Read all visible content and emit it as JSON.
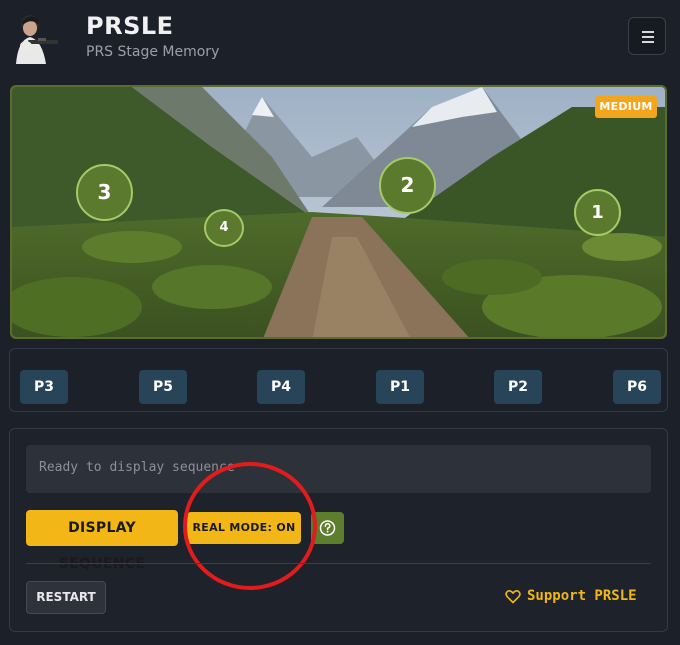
{
  "header": {
    "title": "PRSLE",
    "subtitle": "PRS Stage Memory"
  },
  "stage": {
    "difficulty": "MEDIUM",
    "targets": [
      {
        "label": "3"
      },
      {
        "label": "2"
      },
      {
        "label": "4"
      },
      {
        "label": "1"
      }
    ]
  },
  "positions": [
    "P3",
    "P5",
    "P4",
    "P1",
    "P2",
    "P6"
  ],
  "controls": {
    "status_text": "Ready to display sequence",
    "display_label": "DISPLAY SEQUENCE",
    "real_mode_label": "REAL MODE: ON",
    "restart_label": "RESTART",
    "support_label": "Support PRSLE"
  },
  "colors": {
    "accent": "#f2b716",
    "badge": "#f2a51d",
    "target": "#5b7a2e",
    "position_button": "#274459",
    "annotation": "#e01c1c"
  },
  "icons": [
    "shooter-logo",
    "hamburger-icon",
    "question-circle-icon",
    "heart-icon"
  ]
}
